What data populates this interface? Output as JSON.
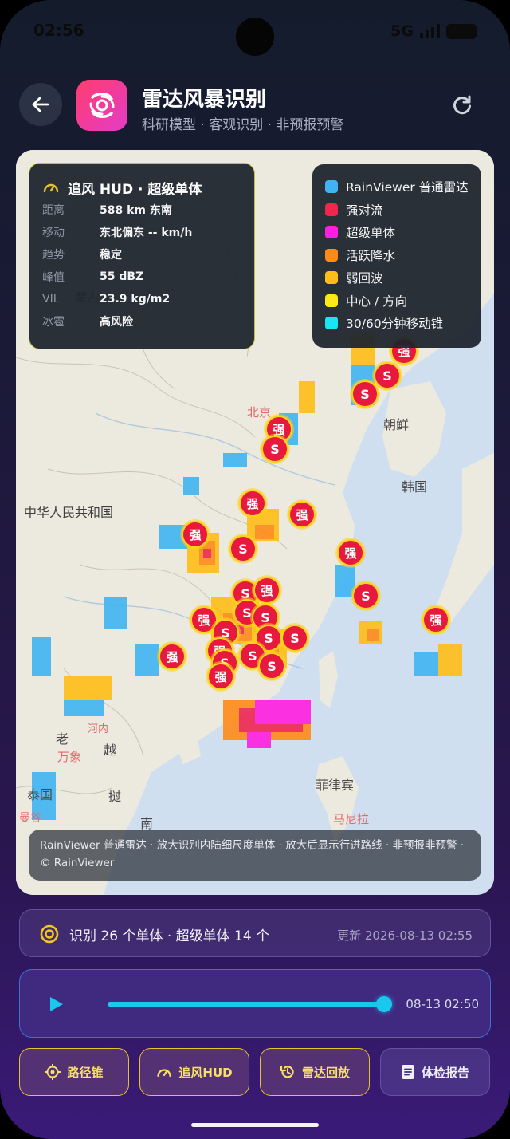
{
  "status": {
    "time": "02:56",
    "network": "5G"
  },
  "header": {
    "title": "雷达风暴识别",
    "subtitle": "科研模型 · 客观识别 · 非预报预警"
  },
  "hud": {
    "title": "追风 HUD · 超级单体",
    "rows": [
      {
        "key": "距离",
        "value": "588 km 东南"
      },
      {
        "key": "移动",
        "value": "东北偏东 -- km/h"
      },
      {
        "key": "趋势",
        "value": "稳定"
      },
      {
        "key": "峰值",
        "value": "55 dBZ"
      },
      {
        "key": "VIL",
        "value": "23.9 kg/m2"
      },
      {
        "key": "冰雹",
        "value": "高风险"
      }
    ]
  },
  "legend": [
    {
      "label": "RainViewer 普通雷达",
      "color": "#3fb4f2"
    },
    {
      "label": "强对流",
      "color": "#f0264f"
    },
    {
      "label": "超级单体",
      "color": "#ff1ee0"
    },
    {
      "label": "活跃降水",
      "color": "#ff8a18"
    },
    {
      "label": "弱回波",
      "color": "#ffbe17"
    },
    {
      "label": "中心 / 方向",
      "color": "#ffe81a"
    },
    {
      "label": "30/60分钟移动锥",
      "color": "#18e6f2"
    }
  ],
  "map": {
    "places": [
      "北京",
      "朝鲜",
      "韩国",
      "中华人民共和国",
      "老",
      "万象",
      "河内",
      "越",
      "泰国",
      "挝",
      "曼谷",
      "南",
      "菲律宾",
      "马尼拉",
      "蒙古"
    ],
    "marker_labels": {
      "strong": "强",
      "supercell": "S"
    }
  },
  "chart_data": {
    "type": "scatter",
    "title": "",
    "series": [
      {
        "name": "强对流",
        "marker": "强",
        "count": 12
      },
      {
        "name": "超级单体",
        "marker": "S",
        "count": 14
      }
    ],
    "total_cells": 26
  },
  "attribution": "RainViewer 普通雷达 · 放大识别内陆细尺度单体 · 放大后显示行进路线 · 非预报非预警 · © RainViewer",
  "summary": {
    "text": "识别 26 个单体 · 超级单体 14 个",
    "updated": "更新 2026-08-13 02:55"
  },
  "player": {
    "time": "08-13 02:50",
    "progress": 0.99
  },
  "actions": [
    {
      "label": "路径锥",
      "icon": "crosshair-icon"
    },
    {
      "label": "追风HUD",
      "icon": "gauge-icon"
    },
    {
      "label": "雷达回放",
      "icon": "history-icon"
    },
    {
      "label": "体检报告",
      "icon": "report-icon"
    }
  ],
  "colors": {
    "accent": "#e7c22a",
    "cyan": "#19c8ec",
    "marker": "#e8193e"
  }
}
